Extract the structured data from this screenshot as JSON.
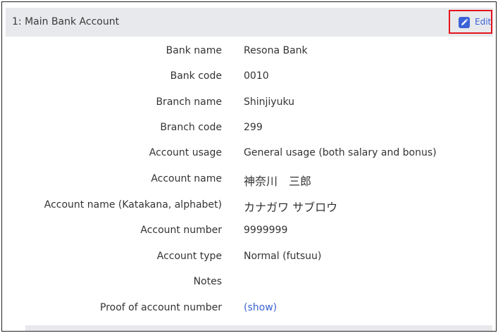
{
  "panel": {
    "title": "1: Main Bank Account",
    "edit_label": "Edit"
  },
  "rows": [
    {
      "label": "Bank name",
      "value": "Resona Bank"
    },
    {
      "label": "Bank code",
      "value": "0010"
    },
    {
      "label": "Branch name",
      "value": "Shinjiyuku"
    },
    {
      "label": "Branch code",
      "value": "299"
    },
    {
      "label": "Account usage",
      "value": "General usage (both salary and bonus)"
    },
    {
      "label": "Account name",
      "value": "神奈川　三郎"
    },
    {
      "label": "Account name (Katakana, alphabet)",
      "value": "カナガワ サブロウ"
    },
    {
      "label": "Account number",
      "value": "9999999"
    },
    {
      "label": "Account type",
      "value": "Normal (futsuu)"
    },
    {
      "label": "Notes",
      "value": ""
    },
    {
      "label": "Proof of account number",
      "value": "(show)"
    }
  ],
  "icons": {
    "edit": "pencil-icon"
  },
  "colors": {
    "link": "#3b63d6",
    "highlight_border": "#e5141c",
    "header_bg": "#e8e9ec"
  }
}
